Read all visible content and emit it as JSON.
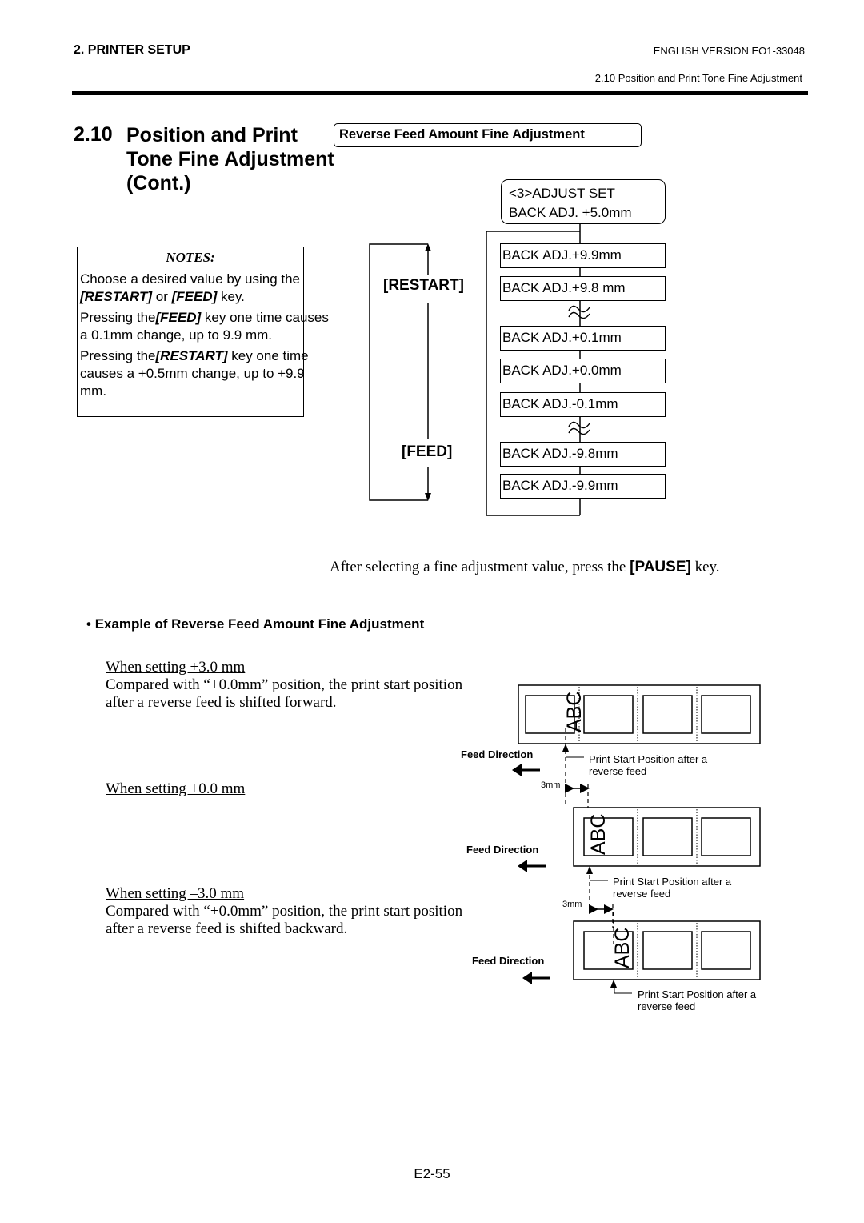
{
  "header": {
    "section": "2. PRINTER SETUP",
    "version": "ENGLISH VERSION EO1-33048",
    "subsection": "2.10 Position and Print Tone Fine Adjustment"
  },
  "title": {
    "number": "2.10",
    "text": "Position and Print Tone Fine Adjustment (Cont.)"
  },
  "section_box": "Reverse Feed Amount Fine Adjustment",
  "lcd": {
    "line1": "<3>ADJUST SET",
    "line2": "BACK ADJ. +5.0mm"
  },
  "notes": {
    "title": "NOTES:",
    "p1_pre": "Choose a desired value by using the ",
    "p1_key1": "[RESTART]",
    "p1_mid": " or ",
    "p1_key2": "[FEED]",
    "p1_post": " key.",
    "p2_pre": "Pressing the",
    "p2_key": "[FEED]",
    "p2_post": " key one time causes a 0.1mm change, up to  9.9 mm.",
    "p3_pre": "Pressing the",
    "p3_key": "[RESTART]",
    "p3_post": " key one time causes a +0.5mm change, up to +9.9 mm."
  },
  "flow": {
    "restart_label": "[RESTART]",
    "feed_label": "[FEED]",
    "menu_items": [
      "BACK ADJ.+9.9mm",
      "BACK ADJ.+9.8 mm",
      "BACK ADJ.+0.1mm",
      "BACK ADJ.+0.0mm",
      "BACK ADJ.-0.1mm",
      "BACK ADJ.-9.8mm",
      "BACK ADJ.-9.9mm"
    ],
    "break_symbol": "≈"
  },
  "pause_line": {
    "pre": "After selecting a fine adjustment value, press the ",
    "key": "[PAUSE]",
    "post": " key."
  },
  "example": {
    "heading": "Example of Reverse Feed Amount Fine Adjustment",
    "bullet": "•",
    "cases": [
      {
        "title": "When setting +3.0 mm",
        "desc": "Compared with “+0.0mm” position, the print start position after a reverse feed is shifted forward."
      },
      {
        "title": "When setting +0.0 mm",
        "desc": ""
      },
      {
        "title": "When setting –3.0 mm",
        "desc": "Compared with “+0.0mm” position, the print start position after a reverse feed is shifted backward."
      }
    ],
    "feed_direction": "Feed Direction",
    "print_start_line1": "Print Start Position after a",
    "print_start_line2": "reverse feed",
    "shift_label": "3mm",
    "label_text": "ABC"
  },
  "page_number": "E2-55"
}
